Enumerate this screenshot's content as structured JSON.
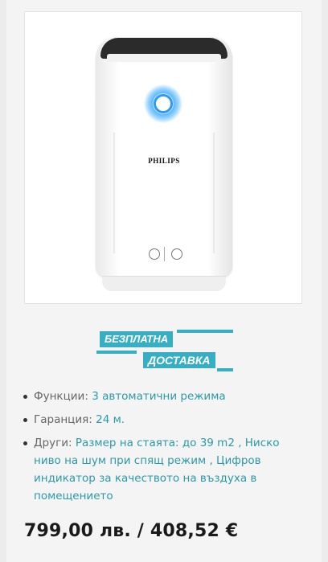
{
  "product": {
    "brand": "PHILIPS",
    "image_icon": "air-purifier-product-image"
  },
  "banner": {
    "line1": "БЕЗПЛАТНА",
    "line2": "ДОСТАВКА",
    "color": "#36afc5"
  },
  "specs": [
    {
      "label": "Функции:",
      "value": "3 автоматични режима"
    },
    {
      "label": "Гаранция:",
      "value": "24 м."
    },
    {
      "label": "Други:",
      "value": "Размер на стаята: до 39 m2 , Ниско ниво на шум при спящ режим , Цифров индикатор за качеството на въздуха в помещението"
    }
  ],
  "price": {
    "text": "799,00 лв. / 408,52 €"
  },
  "colors": {
    "accent": "#2a9aa9",
    "label": "#666666",
    "price": "#1a1a1a"
  }
}
